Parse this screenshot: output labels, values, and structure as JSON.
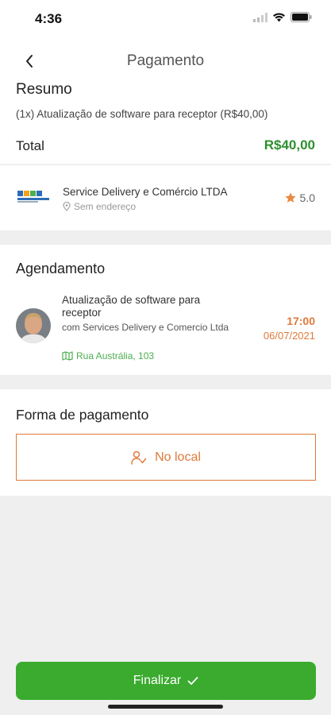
{
  "status_bar": {
    "time": "4:36"
  },
  "nav": {
    "title": "Pagamento"
  },
  "summary": {
    "title": "Resumo",
    "item": "(1x) Atualização de software para receptor (R$40,00)",
    "total_label": "Total",
    "total_value": "R$40,00"
  },
  "provider": {
    "name": "Service Delivery e Comércio LTDA",
    "address": "Sem endereço",
    "rating": "5.0"
  },
  "schedule": {
    "title": "Agendamento",
    "service_name": "Atualização de software para receptor",
    "with_text": "com Services Delivery e Comercio Ltda",
    "address": "Rua Austrália, 103",
    "time": "17:00",
    "date": "06/07/2021"
  },
  "payment": {
    "title": "Forma de pagamento",
    "option_label": "No local"
  },
  "footer": {
    "finalize_label": "Finalizar"
  },
  "colors": {
    "accent_green": "#3aab2e",
    "price_green": "#2f8f2f",
    "accent_orange": "#e07a3a"
  }
}
